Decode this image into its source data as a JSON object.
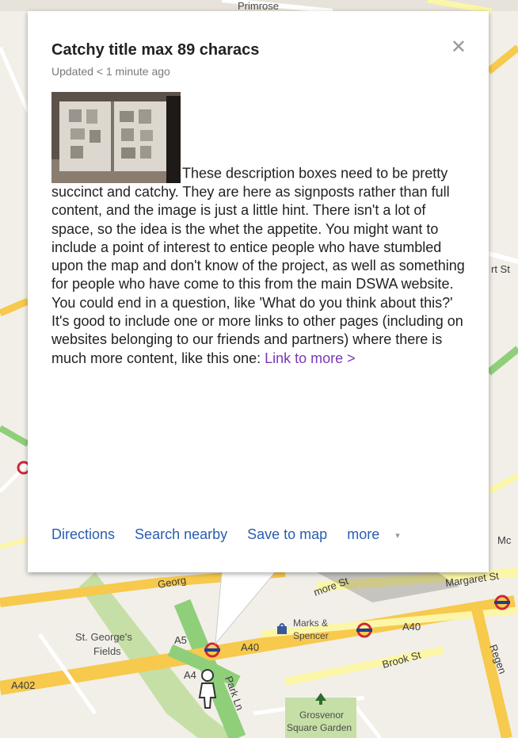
{
  "map": {
    "labels": {
      "primrose": "Primrose",
      "st_georges_fields": [
        "St. George's",
        "Fields"
      ],
      "a5": "A5",
      "a40_left": "A40",
      "a40_right": "A40",
      "a402": "A402",
      "a4": "A4",
      "park_ln": "Park Ln",
      "marks_spencer": [
        "Marks &",
        "Spencer"
      ],
      "brook_st": "Brook St",
      "regent": "Regen",
      "grosvenor": [
        "Grosvenor",
        "Square Garden"
      ],
      "margaret_st": "Margaret St",
      "more_st": "more St",
      "george": "Georg",
      "rt_st": "rt St",
      "m_right": "Mc"
    },
    "colors": {
      "base": "#f2efe9",
      "park": "#c6dfa6",
      "road_major": "#f7c94c",
      "road_mid": "#fcf6a8",
      "road_green": "#8fcf7a",
      "underground": "#cc2936"
    }
  },
  "infowindow": {
    "title": "Catchy title max 89 characs",
    "updated": "Updated < 1 minute ago",
    "close_glyph": "✕",
    "image_alt": "sketchbook-photo",
    "description": "These description boxes need to be pretty succinct and catchy. They are here as signposts rather than full content, and the image is just a little hint. There isn't a lot of space, so the idea is the whet the appetite. You might want to include a point of interest to entice people who have stumbled upon the map and don't know of the project, as well as something for people who have come to this from the main DSWA website. You could end in a question, like 'What do you think about this?' It's good to include one or more links to other pages (including on websites belonging to our friends and partners) where there is much more content, like this one: ",
    "link_text": "Link to more >",
    "actions": {
      "directions": "Directions",
      "search_nearby": "Search nearby",
      "save_to_map": "Save to map",
      "more": "more",
      "more_caret": "▾"
    }
  }
}
